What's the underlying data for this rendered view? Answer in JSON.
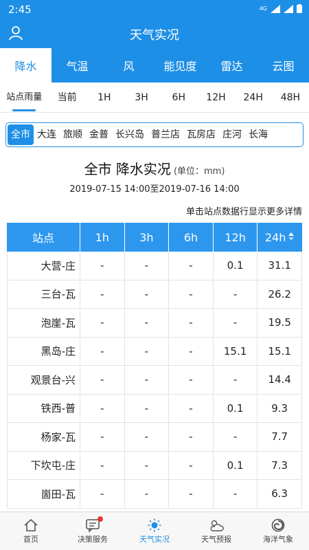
{
  "status": {
    "time": "2:45",
    "network": "4G"
  },
  "header": {
    "title": "天气实况"
  },
  "tabs": [
    "降水",
    "气温",
    "风",
    "能见度",
    "雷达",
    "云图"
  ],
  "subtabs": [
    "站点雨量",
    "当前",
    "1H",
    "3H",
    "6H",
    "12H",
    "24H",
    "48H"
  ],
  "filters": [
    "全市",
    "大连",
    "旅顺",
    "金普",
    "长兴岛",
    "普兰店",
    "瓦房店",
    "庄河",
    "长海"
  ],
  "section": {
    "title": "全市 降水实况",
    "unit": "(单位：mm)",
    "range": "2019-07-15 14:00至2019-07-16 14:00",
    "hint": "单击站点数据行显示更多详情"
  },
  "table": {
    "columns": [
      "站点",
      "1h",
      "3h",
      "6h",
      "12h",
      "24h"
    ],
    "rows": [
      [
        "大营-庄",
        "-",
        "-",
        "-",
        "0.1",
        "31.1"
      ],
      [
        "三台-瓦",
        "-",
        "-",
        "-",
        "-",
        "26.2"
      ],
      [
        "泡崖-瓦",
        "-",
        "-",
        "-",
        "-",
        "19.5"
      ],
      [
        "黑岛-庄",
        "-",
        "-",
        "-",
        "15.1",
        "15.1"
      ],
      [
        "观景台-兴",
        "-",
        "-",
        "-",
        "-",
        "14.4"
      ],
      [
        "铁西-普",
        "-",
        "-",
        "-",
        "0.1",
        "9.3"
      ],
      [
        "杨家-瓦",
        "-",
        "-",
        "-",
        "-",
        "7.7"
      ],
      [
        "下坎屯-庄",
        "-",
        "-",
        "-",
        "0.1",
        "7.3"
      ],
      [
        "崮田-瓦",
        "-",
        "-",
        "-",
        "-",
        "6.3"
      ]
    ]
  },
  "bottom_nav": [
    "首页",
    "决策服务",
    "天气实况",
    "天气预报",
    "海洋气象"
  ],
  "colors": {
    "accent": "#1e8fe6",
    "header_cell": "#2d97ee",
    "badge": "#e53935"
  }
}
